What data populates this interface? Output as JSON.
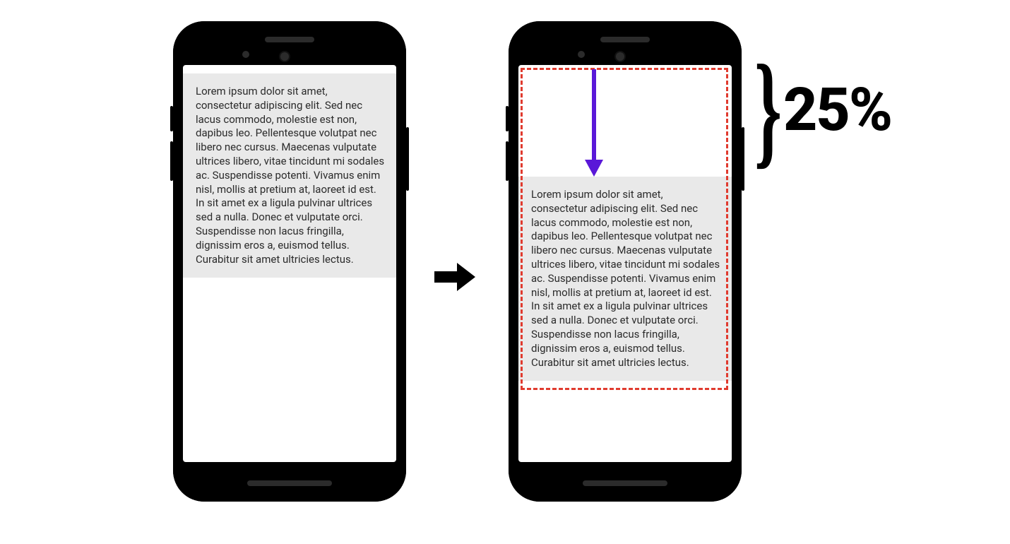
{
  "diagram": {
    "body_text": "Lorem ipsum dolor sit amet, consectetur adipiscing elit. Sed nec lacus commodo, molestie est non, dapibus leo. Pellentesque volutpat nec libero nec cursus. Maecenas vulputate ultrices libero, vitae tincidunt mi sodales ac. Suspendisse potenti. Vivamus enim nisl, mollis at pretium at, laoreet id est. In sit amet ex a ligula pulvinar ultrices sed a nulla. Donec et vulputate orci. Suspendisse non lacus fringilla, dignissim eros a, euismod tellus. Curabitur sit amet ultricies lectus.",
    "shift_label": "25%",
    "colors": {
      "phone_body": "#000000",
      "screen_bg": "#ffffff",
      "text_block_bg": "#e9e9e9",
      "dashed_outline": "#e03b2f",
      "shift_arrow": "#5a18d8",
      "transition_arrow": "#000000"
    }
  }
}
